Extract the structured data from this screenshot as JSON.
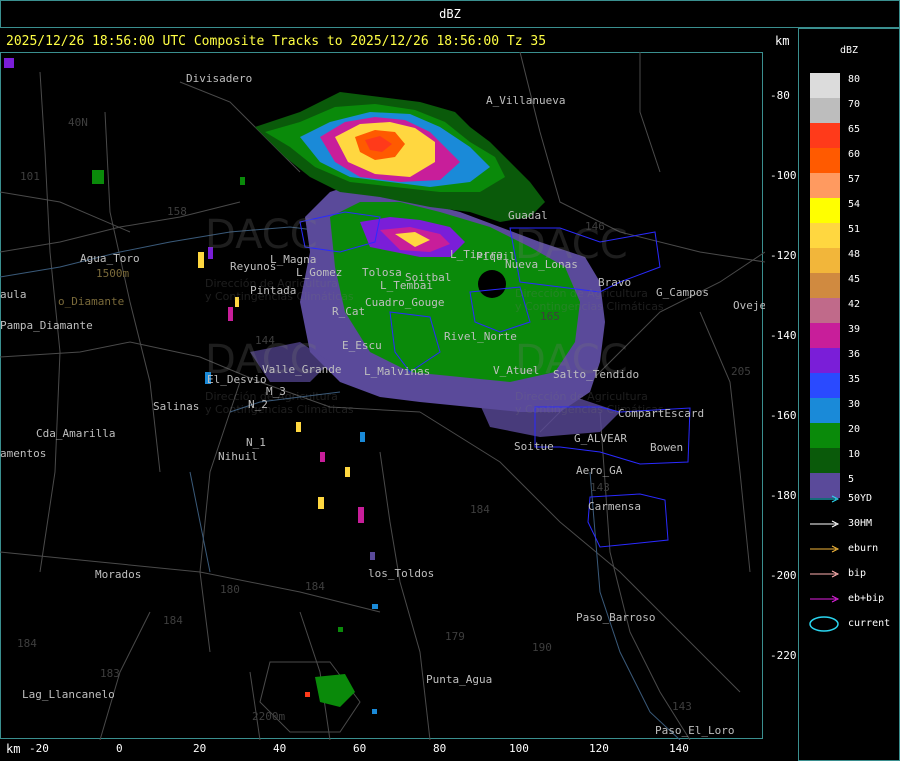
{
  "window": {
    "title": "dBZ"
  },
  "header": {
    "info_line": "2025/12/26 18:56:00 UTC Composite Tracks to 2025/12/26 18:56:00 Tz 35",
    "y_unit": "km",
    "x_unit": "km"
  },
  "axes": {
    "y_ticks": [
      "-80",
      "-100",
      "-120",
      "-140",
      "-160",
      "-180",
      "-200",
      "-220"
    ],
    "x_ticks": [
      "-20",
      "0",
      "20",
      "40",
      "60",
      "80",
      "100",
      "120",
      "140"
    ]
  },
  "legend": {
    "title": "dBZ",
    "levels": [
      {
        "label": "80",
        "color": "#dcdcdc"
      },
      {
        "label": "70",
        "color": "#bdbdbd"
      },
      {
        "label": "65",
        "color": "#ff3a1a"
      },
      {
        "label": "60",
        "color": "#ff5a00"
      },
      {
        "label": "57",
        "color": "#ff9a60"
      },
      {
        "label": "54",
        "color": "#ffff00"
      },
      {
        "label": "51",
        "color": "#ffd740"
      },
      {
        "label": "48",
        "color": "#f2b63a"
      },
      {
        "label": "45",
        "color": "#d08a40"
      },
      {
        "label": "42",
        "color": "#c06a8a"
      },
      {
        "label": "39",
        "color": "#c81e9a"
      },
      {
        "label": "36",
        "color": "#7a1ed8"
      },
      {
        "label": "35",
        "color": "#2a4aff"
      },
      {
        "label": "30",
        "color": "#1a8ad8"
      },
      {
        "label": "20",
        "color": "#0a8a0a"
      },
      {
        "label": "10",
        "color": "#0a5a0a"
      },
      {
        "label": "5",
        "color": "#5a4a9a"
      }
    ],
    "tracks": [
      {
        "label": "50YD",
        "color": "#2ad6f0"
      },
      {
        "label": "30HM",
        "color": "#ffffff"
      },
      {
        "label": "eburn",
        "color": "#f2b63a"
      },
      {
        "label": "bip",
        "color": "#ffb0b0"
      },
      {
        "label": "eb+bip",
        "color": "#e020e0"
      }
    ],
    "current_label": "current",
    "current_color": "#2ad6f0"
  },
  "places": [
    {
      "name": "Divisadero"
    },
    {
      "name": "A_Villanueva"
    },
    {
      "name": "40N"
    },
    {
      "name": "101"
    },
    {
      "name": "158"
    },
    {
      "name": "Agua_Toro"
    },
    {
      "name": "1500m"
    },
    {
      "name": "o_Diamante"
    },
    {
      "name": "aula"
    },
    {
      "name": "Pampa_Diamante"
    },
    {
      "name": "Reyunos"
    },
    {
      "name": "Pintada"
    },
    {
      "name": "L_Magna"
    },
    {
      "name": "L_Gomez"
    },
    {
      "name": "Tolosa"
    },
    {
      "name": "Soitbal"
    },
    {
      "name": "L_Tembai"
    },
    {
      "name": "Guadal"
    },
    {
      "name": "L_Tierra"
    },
    {
      "name": "Piquil"
    },
    {
      "name": "Nueva_Lonas"
    },
    {
      "name": "Bravo"
    },
    {
      "name": "G_Campos"
    },
    {
      "name": "Ovejer"
    },
    {
      "name": "R_Cat"
    },
    {
      "name": "Cuadro_Gouge"
    },
    {
      "name": "Rivel_Norte"
    },
    {
      "name": "E_Escu"
    },
    {
      "name": "L_Malvinas"
    },
    {
      "name": "V_Atuel"
    },
    {
      "name": "Salto_Tendido"
    },
    {
      "name": "El_Desvio"
    },
    {
      "name": "Valle_Grande"
    },
    {
      "name": "Salinas"
    },
    {
      "name": "N_2"
    },
    {
      "name": "M_3"
    },
    {
      "name": "Cda_Amarilla"
    },
    {
      "name": "amentos"
    },
    {
      "name": "N_1"
    },
    {
      "name": "Nihuil"
    },
    {
      "name": "Soitue"
    },
    {
      "name": "G_ALVEAR"
    },
    {
      "name": "CompartEscard"
    },
    {
      "name": "Bowen"
    },
    {
      "name": "Aero_GA"
    },
    {
      "name": "Carmensa"
    },
    {
      "name": "Morados"
    },
    {
      "name": "los_Toldos"
    },
    {
      "name": "180"
    },
    {
      "name": "184"
    },
    {
      "name": "184"
    },
    {
      "name": "179"
    },
    {
      "name": "190"
    },
    {
      "name": "Paso_Barroso"
    },
    {
      "name": "184"
    },
    {
      "name": "183"
    },
    {
      "name": "Lag_Llancanelo"
    },
    {
      "name": "Punta_Agua"
    },
    {
      "name": "2200m"
    },
    {
      "name": "143"
    },
    {
      "name": "Paso_El_Loro"
    },
    {
      "name": "205"
    },
    {
      "name": "184"
    },
    {
      "name": "146"
    },
    {
      "name": "143"
    },
    {
      "name": "144"
    },
    {
      "name": "165"
    }
  ],
  "watermark": {
    "brand": "DACC",
    "subtitle_1": "Dirección de Agricultura",
    "subtitle_2": "y Contingencias Climáticas"
  }
}
